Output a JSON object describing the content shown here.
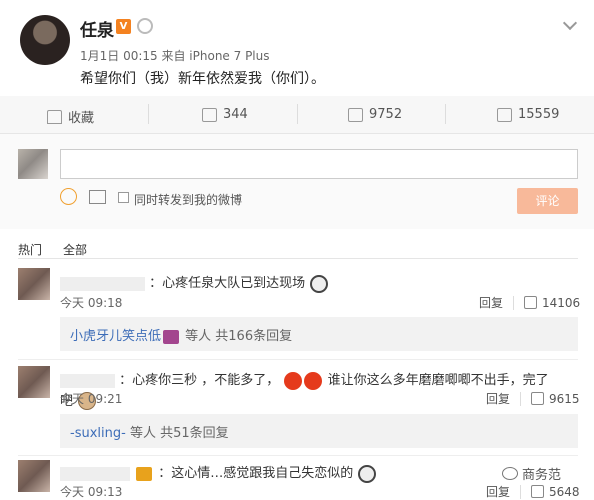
{
  "post": {
    "author": "任泉",
    "v_badge": "V",
    "meta": "1月1日 00:15 来自 iPhone 7 Plus",
    "content": "希望你们（我）新年依然爱我（你们）。"
  },
  "actions": {
    "collect": "收藏",
    "forward": "344",
    "comment": "9752",
    "like": "15559"
  },
  "compose": {
    "input_placeholder": "",
    "forward_label": "同时转发到我的微博",
    "submit": "评论"
  },
  "tabs": [
    "热门",
    "全部"
  ],
  "comments": [
    {
      "text": "：心疼任泉大队已到达现场",
      "time": "今天 09:18",
      "reply": "回复",
      "likes": "14106",
      "replies_user": "小虎牙儿笑点低",
      "replies_text": "等人 共166条回复"
    },
    {
      "text_a": "：心疼你三秒 ，不能多了，",
      "text_b": "谁让你这么多年磨磨唧唧不出手，完了吧",
      "time": "今天 09:21",
      "reply": "回复",
      "likes": "9615",
      "replies_user": "-suxling-",
      "replies_text": "等人 共51条回复"
    },
    {
      "text": "：这心情…感觉跟我自己失恋似的",
      "time": "今天 09:13",
      "reply": "回复",
      "likes": "5648"
    }
  ],
  "watermark": "商务范",
  "colors": {
    "accent": "#3d6db8",
    "submit_bg": "#f8b99a",
    "badge": "#f48220"
  }
}
